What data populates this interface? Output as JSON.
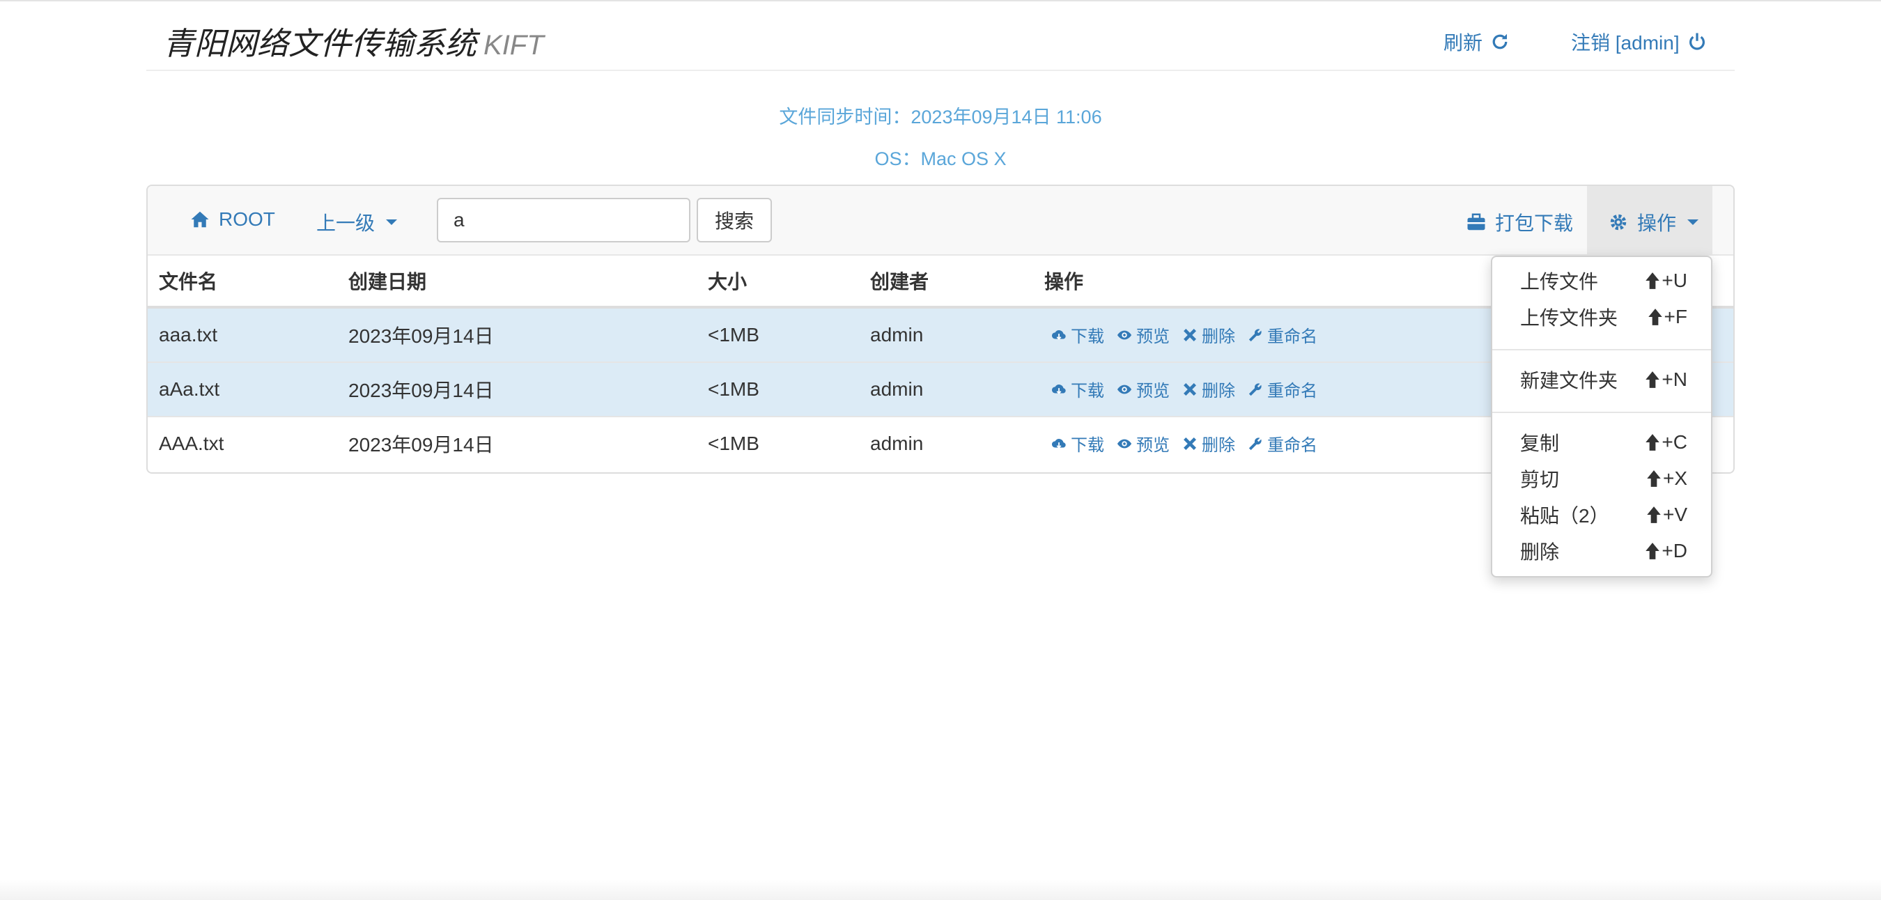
{
  "header": {
    "brand_title": "青阳网络文件传输系统",
    "brand_sub": "KIFT",
    "refresh_label": "刷新",
    "logout_label": "注销 [admin]"
  },
  "info": {
    "sync_label": "文件同步时间：",
    "sync_time": "2023年09月14日 11:06",
    "os_label": "OS：",
    "os_value": "Mac OS X"
  },
  "toolbar": {
    "root_label": "ROOT",
    "parent_label": "上一级",
    "search_value": "a",
    "search_button": "搜索",
    "pack_download_label": "打包下载",
    "operations_label": "操作"
  },
  "table": {
    "columns": [
      "文件名",
      "创建日期",
      "大小",
      "创建者",
      "操作"
    ],
    "rows": [
      {
        "name": "aaa.txt",
        "date": "2023年09月14日",
        "size": "<1MB",
        "creator": "admin",
        "selected": true
      },
      {
        "name": "aAa.txt",
        "date": "2023年09月14日",
        "size": "<1MB",
        "creator": "admin",
        "selected": true
      },
      {
        "name": "AAA.txt",
        "date": "2023年09月14日",
        "size": "<1MB",
        "creator": "admin",
        "selected": false
      }
    ],
    "actions": {
      "download": "下载",
      "preview": "预览",
      "delete": "删除",
      "rename": "重命名"
    }
  },
  "menu": {
    "items": [
      {
        "label": "上传文件",
        "key": "+U"
      },
      {
        "label": "上传文件夹",
        "key": "+F"
      },
      {
        "label": "新建文件夹",
        "key": "+N"
      },
      {
        "label": "复制",
        "key": "+C"
      },
      {
        "label": "剪切",
        "key": "+X"
      },
      {
        "label": "粘贴（2）",
        "key": "+V"
      },
      {
        "label": "删除",
        "key": "+D"
      }
    ]
  },
  "colors": {
    "link": "#337ab7",
    "info": "#5bc0de",
    "selected_row": "#dcebf6"
  }
}
